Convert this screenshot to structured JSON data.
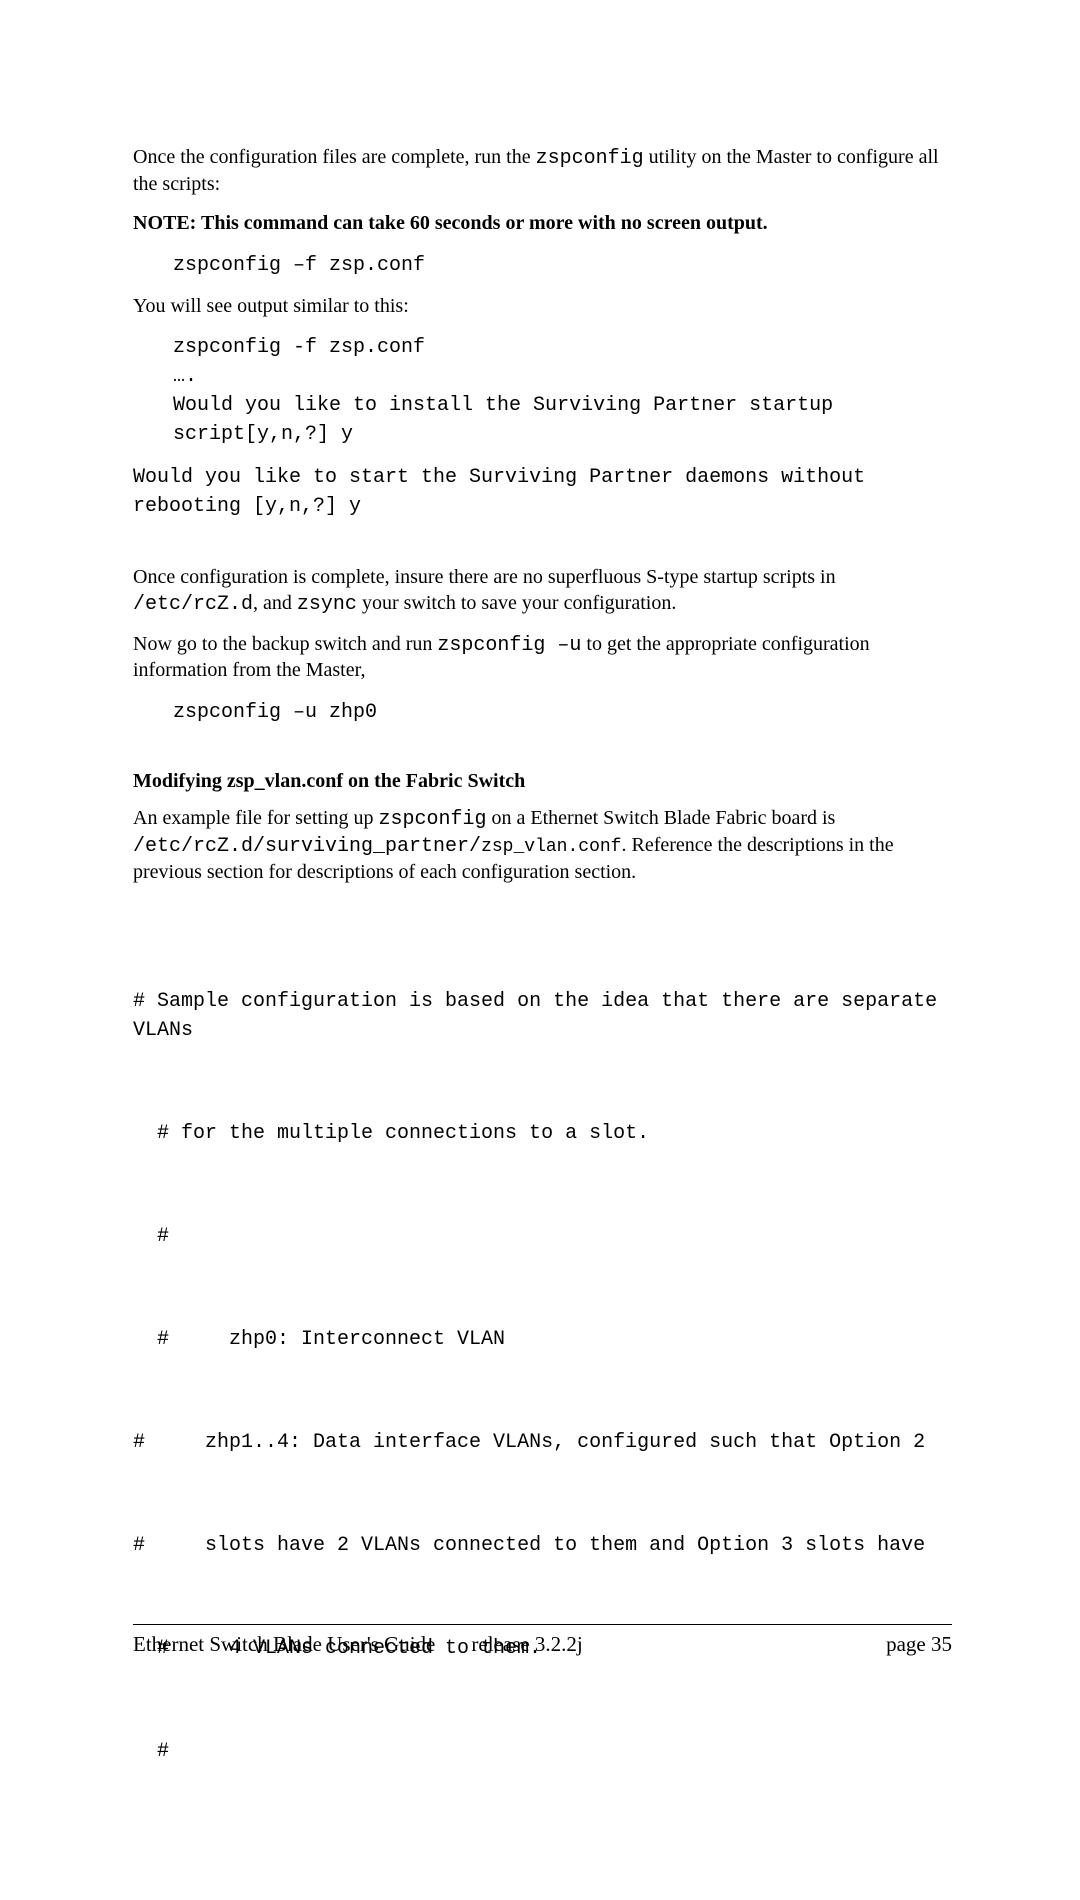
{
  "p1": {
    "a": "Once the configuration files are complete, run the ",
    "b": "zspconfig",
    "c": " utility on the Master to configure all the scripts:"
  },
  "note": "NOTE: This command can take 60 seconds or more with no screen output.",
  "code1": "zspconfig –f zsp.conf",
  "p2": "You will see output similar to this:",
  "code2": "zspconfig -f zsp.conf\n….\nWould you like to install the Surviving Partner startup\nscript[y,n,?] y",
  "code2b": "Would you like to start the Surviving Partner daemons without\nrebooting [y,n,?] y",
  "p3": {
    "a": "Once configuration is complete, insure there are no superfluous S-type startup scripts in ",
    "b": "/etc/rcZ.d",
    "c": ", and ",
    "d": "zsync",
    "e": " your switch to save your configuration."
  },
  "p4": {
    "a": "Now go to the backup switch and run ",
    "b": "zspconfig –u",
    "c": " to get the appropriate configuration information from the Master,"
  },
  "code3": "zspconfig –u zhp0",
  "subhead": "Modifying zsp_vlan.conf on the Fabric Switch",
  "p5": {
    "a": "An example file for setting up ",
    "b": "zspconfig",
    "c": " on a Ethernet Switch Blade Fabric board is ",
    "d": "/etc/rcZ.d/surviving_partner/",
    "e": "zsp_vlan.conf",
    "f": ". Reference the descriptions in the previous section for descriptions of each configuration section."
  },
  "sample": {
    "l1": "# Sample configuration is based on the idea that there are separate VLANs",
    "l2": "# for the multiple connections to a slot.",
    "l3": "#",
    "l4": "#     zhp0: Interconnect VLAN",
    "l5": "#     zhp1..4: Data interface VLANs, configured such that Option 2",
    "l6": "#     slots have 2 VLANs connected to them and Option 3 slots have",
    "l7": "#     4 VLANs connected to them.",
    "l8": "#"
  },
  "footer": {
    "title": "Ethernet Switch Blade User's Guide",
    "release": "release  3.2.2j",
    "page": "page 35"
  }
}
